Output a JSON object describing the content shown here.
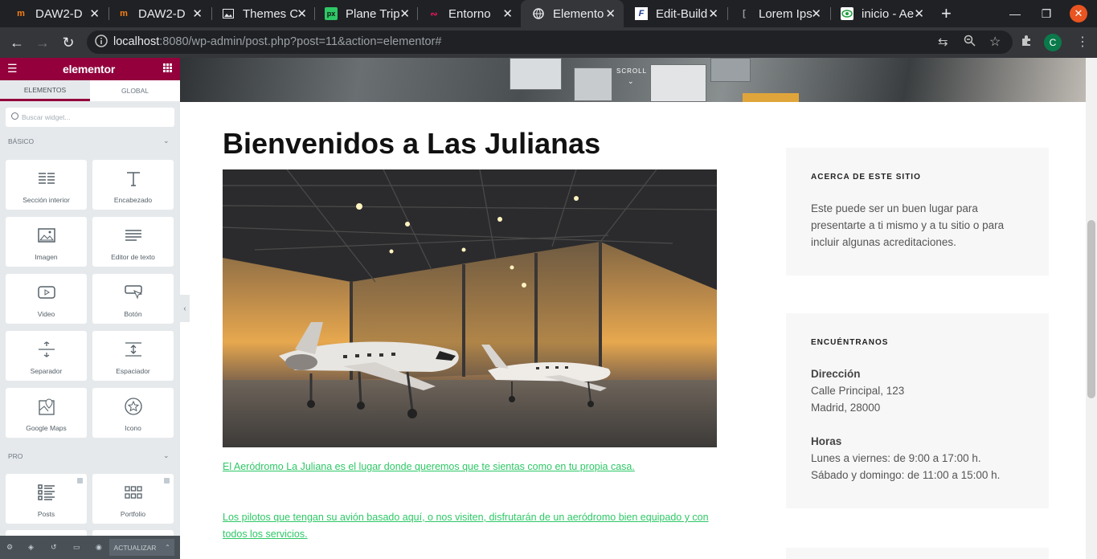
{
  "browser": {
    "tabs": [
      {
        "title": "DAW2-D",
        "icon": "moodle-icon"
      },
      {
        "title": "DAW2-D",
        "icon": "moodle-icon"
      },
      {
        "title": "Themes C",
        "icon": "image-icon"
      },
      {
        "title": "Plane Trip",
        "icon": "px-icon"
      },
      {
        "title": "Entorno",
        "icon": "wave-icon"
      },
      {
        "title": "Elemento",
        "icon": "globe-icon"
      },
      {
        "title": "Edit-Build",
        "icon": "f-icon"
      },
      {
        "title": "Lorem Ips",
        "icon": "lorem-icon"
      },
      {
        "title": "inicio - Ae",
        "icon": "eye-icon"
      }
    ],
    "url_host": "localhost",
    "url_rest": ":8080/wp-admin/post.php?post=11&action=elementor#",
    "avatar_letter": "C"
  },
  "elementor": {
    "logo": "elementor",
    "tab_elements": "ELEMENTOS",
    "tab_global": "GLOBAL",
    "search_placeholder": "Buscar widget...",
    "section_basic": "BÁSICO",
    "section_pro": "PRO",
    "widgets": [
      {
        "label": "Sección interior",
        "icon": "columns-icon"
      },
      {
        "label": "Encabezado",
        "icon": "heading-icon"
      },
      {
        "label": "Imagen",
        "icon": "image-icon"
      },
      {
        "label": "Editor de texto",
        "icon": "text-editor-icon"
      },
      {
        "label": "Video",
        "icon": "video-icon"
      },
      {
        "label": "Botón",
        "icon": "button-icon"
      },
      {
        "label": "Separador",
        "icon": "divider-icon"
      },
      {
        "label": "Espaciador",
        "icon": "spacer-icon"
      },
      {
        "label": "Google Maps",
        "icon": "map-icon"
      },
      {
        "label": "Icono",
        "icon": "star-icon"
      }
    ],
    "pro_widgets": [
      {
        "label": "Posts",
        "icon": "posts-icon"
      },
      {
        "label": "Portfolio",
        "icon": "portfolio-icon"
      }
    ],
    "update_label": "ACTUALIZAR"
  },
  "page": {
    "hero_scroll": "SCROLL",
    "title": "Bienvenidos a Las Julianas",
    "paragraph1": "El Aeródromo La Juliana es el lugar donde queremos que te sientas como en tu propia casa.",
    "paragraph2": "Los pilotos que tengan su avión basado aquí, o nos visiten, disfrutarán de un aeródromo bien equipado y con todos los servicios."
  },
  "sidebar": {
    "about_title": "ACERCA DE ESTE SITIO",
    "about_text": "Este puede ser un buen lugar para presentarte a ti mismo y a tu sitio o para incluir algunas acreditaciones.",
    "find_title": "ENCUÉNTRANOS",
    "address_heading": "Dirección",
    "address_line1": "Calle Principal, 123",
    "address_line2": "Madrid, 28000",
    "hours_heading": "Horas",
    "hours_line1": "Lunes a viernes: de 9:00 a 17:00 h.",
    "hours_line2": "Sábado y domingo: de 11:00 a 15:00 h."
  },
  "colors": {
    "elementor_brand": "#93003c",
    "link_green": "#2ec866"
  }
}
